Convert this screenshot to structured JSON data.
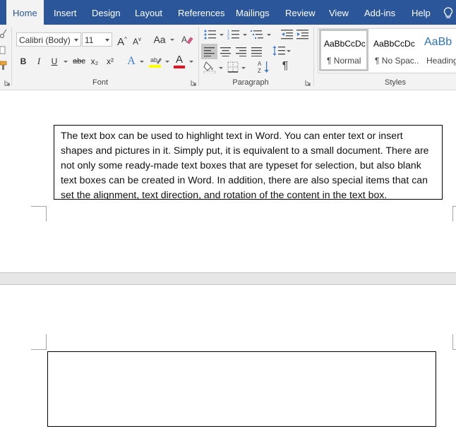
{
  "tabs": [
    {
      "label": "Home",
      "active": true
    },
    {
      "label": "Insert"
    },
    {
      "label": "Design"
    },
    {
      "label": "Layout"
    },
    {
      "label": "References"
    },
    {
      "label": "Mailings"
    },
    {
      "label": "Review"
    },
    {
      "label": "View"
    },
    {
      "label": "Add-ins"
    },
    {
      "label": "Help"
    }
  ],
  "font_group": {
    "label": "Font",
    "font_name": "Calibri (Body)",
    "font_size": "11",
    "change_case": "Aa",
    "bold": "B",
    "italic": "I",
    "underline": "U",
    "strikethrough": "abc",
    "subscript": "x₂",
    "superscript": "x²",
    "text_effects": "A",
    "font_color": "A",
    "grow_font": "A",
    "shrink_font": "A"
  },
  "paragraph_group": {
    "label": "Paragraph",
    "pilcrow": "¶"
  },
  "styles_group": {
    "label": "Styles",
    "items": [
      {
        "sample": "AaBbCcDc",
        "name": "¶ Normal",
        "selected": true
      },
      {
        "sample": "AaBbCcDc",
        "name": "¶ No Spac..."
      },
      {
        "sample": "AaBb",
        "name": "Heading"
      }
    ]
  },
  "colors": {
    "tab_bar": "#2b579a",
    "ribbon": "#f3f3f3",
    "highlight": "#ffff00",
    "font_color": "#e81123"
  },
  "document": {
    "textbox_text": "The text box can be used to highlight text in Word. You can enter text or insert shapes and pictures in it. Simply put, it is equivalent to a small document. There are not only some ready-made text boxes that are typeset for selection, but also blank text boxes can be created in Word. In addition, there are also special items that can set the alignment, text direction, and rotation of the content in the text box."
  }
}
